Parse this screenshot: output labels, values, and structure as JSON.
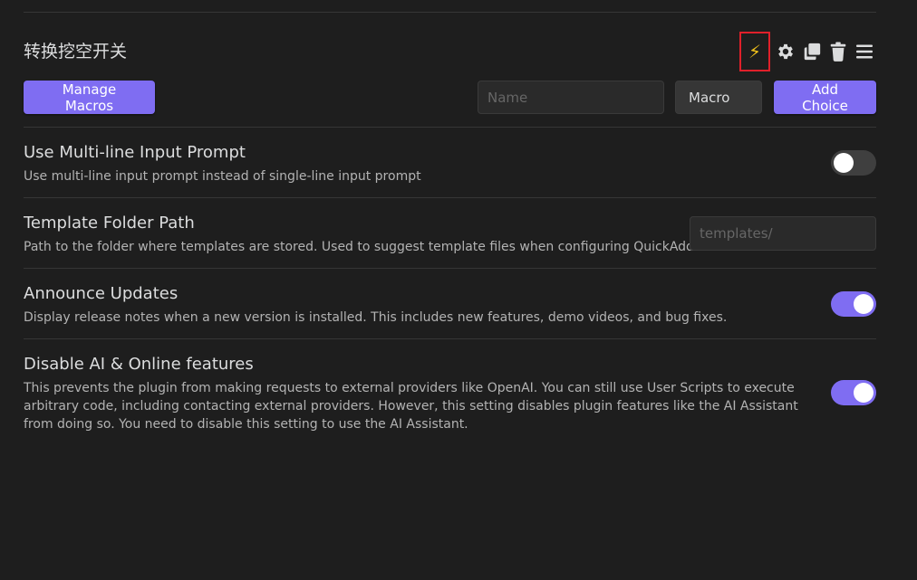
{
  "choice": {
    "name": "转换挖空开关",
    "actions": [
      {
        "icon": "bolt-icon",
        "glyph": "⚡"
      },
      {
        "icon": "gear-icon"
      },
      {
        "icon": "duplicate-icon"
      },
      {
        "icon": "trash-icon"
      },
      {
        "icon": "menu-icon"
      }
    ]
  },
  "controls": {
    "manage_macros_label": "Manage Macros",
    "name_placeholder": "Name",
    "type_value": "Macro",
    "add_choice_label": "Add Choice"
  },
  "settings": [
    {
      "name": "Use Multi-line Input Prompt",
      "description": "Use multi-line input prompt instead of single-line input prompt",
      "control": "toggle",
      "enabled": false
    },
    {
      "name": "Template Folder Path",
      "description": "Path to the folder where templates are stored. Used to suggest template files when configuring QuickAdd.",
      "control": "text",
      "placeholder": "templates/"
    },
    {
      "name": "Announce Updates",
      "description": "Display release notes when a new version is installed. This includes new features, demo videos, and bug fixes.",
      "control": "toggle",
      "enabled": true
    },
    {
      "name": "Disable AI & Online features",
      "description": "This prevents the plugin from making requests to external providers like OpenAI. You can still use User Scripts to execute arbitrary code, including contacting external providers. However, this setting disables plugin features like the AI Assistant from doing so. You need to disable this setting to use the AI Assistant.",
      "control": "toggle",
      "enabled": true
    }
  ],
  "colors": {
    "accent": "#7f6df2",
    "background": "#1e1e1e",
    "bolt": "#f2c21b",
    "highlight_border": "#e0202a"
  }
}
